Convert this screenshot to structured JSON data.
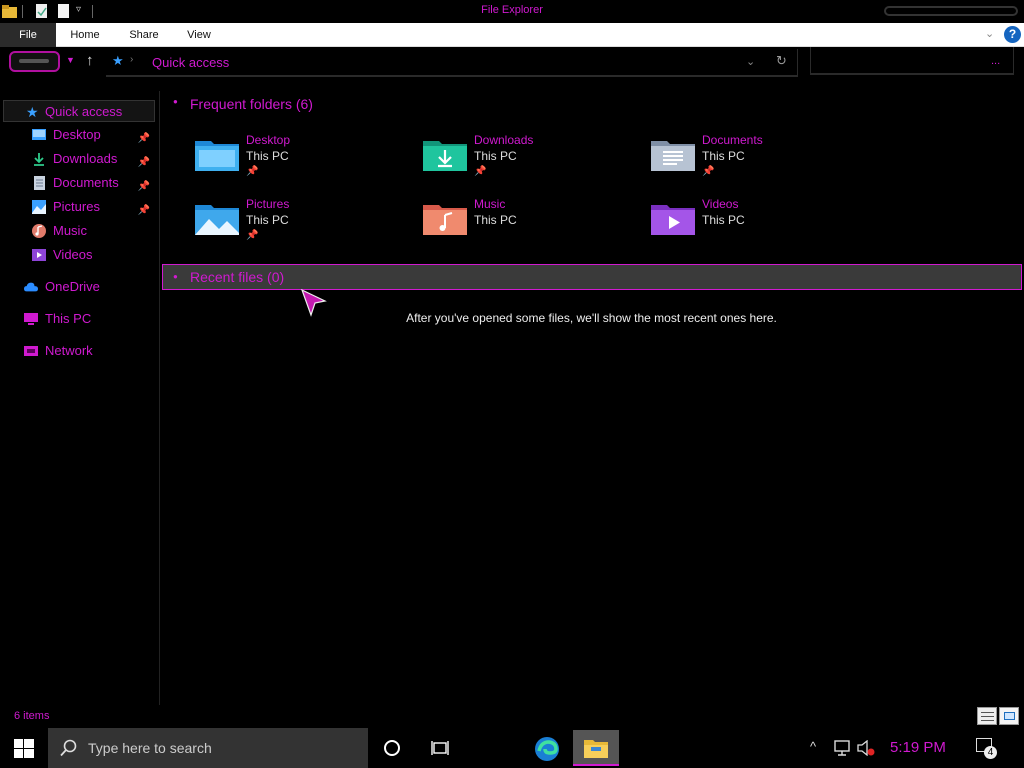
{
  "window": {
    "title": "File Explorer"
  },
  "ribbon": {
    "tabs": [
      "File",
      "Home",
      "Share",
      "View"
    ],
    "help": "?"
  },
  "address": {
    "location": "Quick access",
    "search_more": "..."
  },
  "nav": {
    "items": [
      {
        "label": "Quick access",
        "icon": "star-icon"
      },
      {
        "label": "Desktop",
        "icon": "desktop-icon"
      },
      {
        "label": "Downloads",
        "icon": "download-icon"
      },
      {
        "label": "Documents",
        "icon": "document-icon"
      },
      {
        "label": "Pictures",
        "icon": "picture-icon"
      },
      {
        "label": "Music",
        "icon": "music-icon"
      },
      {
        "label": "Videos",
        "icon": "video-icon"
      },
      {
        "label": "OneDrive",
        "icon": "cloud-icon"
      },
      {
        "label": "This PC",
        "icon": "pc-icon"
      },
      {
        "label": "Network",
        "icon": "network-icon"
      }
    ]
  },
  "frequent": {
    "header": "Frequent folders (6)",
    "folders": [
      {
        "name": "Desktop",
        "location": "This PC"
      },
      {
        "name": "Downloads",
        "location": "This PC"
      },
      {
        "name": "Documents",
        "location": "This PC"
      },
      {
        "name": "Pictures",
        "location": "This PC"
      },
      {
        "name": "Music",
        "location": "This PC"
      },
      {
        "name": "Videos",
        "location": "This PC"
      }
    ]
  },
  "recent": {
    "header": "Recent files (0)",
    "empty_message": "After you've opened some files, we'll show the most recent ones here."
  },
  "status": {
    "items_count": "6 items"
  },
  "taskbar": {
    "search_placeholder": "Type here to search",
    "time": "5:19 PM",
    "notifications_count": "4"
  },
  "colors": {
    "accent": "#d01ad0",
    "background": "#000000"
  }
}
